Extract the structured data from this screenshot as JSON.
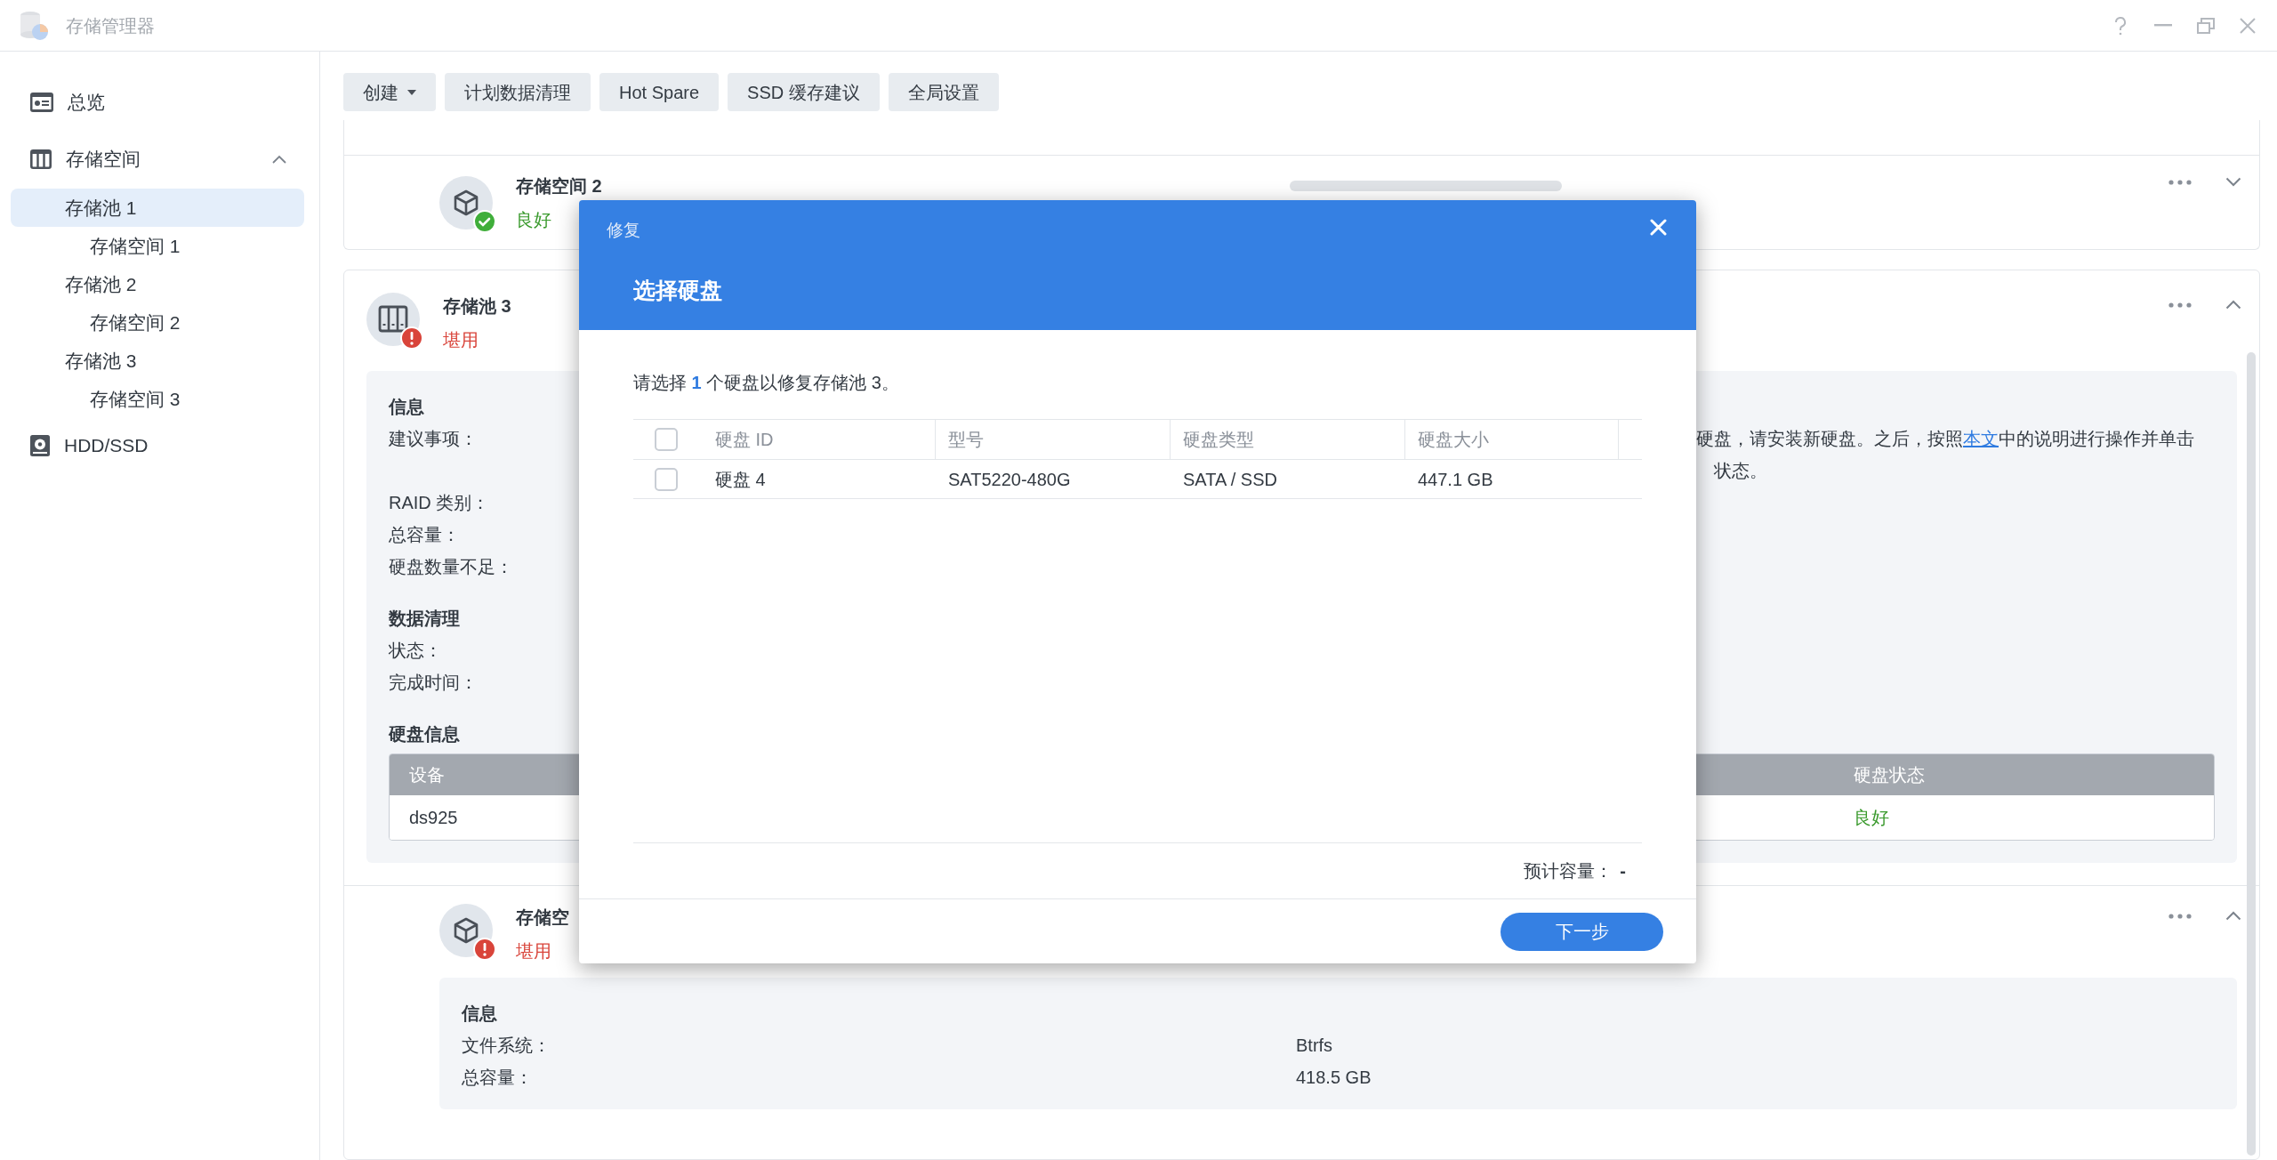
{
  "window": {
    "title": "存储管理器"
  },
  "sidebar": {
    "items": [
      {
        "label": "总览",
        "selected": false
      },
      {
        "label": "存储空间",
        "selected": false,
        "expanded": true,
        "children": [
          {
            "label": "存储池 1",
            "selected": true,
            "children": [
              {
                "label": "存储空间 1",
                "selected": false
              }
            ]
          },
          {
            "label": "存储池 2",
            "selected": false,
            "children": [
              {
                "label": "存储空间 2",
                "selected": false
              }
            ]
          },
          {
            "label": "存储池 3",
            "selected": false,
            "children": [
              {
                "label": "存储空间 3",
                "selected": false
              }
            ]
          }
        ]
      },
      {
        "label": "HDD/SSD",
        "selected": false
      }
    ]
  },
  "toolbar": {
    "buttons": [
      {
        "label": "创建",
        "dropdown": true
      },
      {
        "label": "计划数据清理",
        "dropdown": false
      },
      {
        "label": "Hot Spare",
        "dropdown": false
      },
      {
        "label": "SSD 缓存建议",
        "dropdown": false
      },
      {
        "label": "全局设置",
        "dropdown": false
      }
    ]
  },
  "storage_space_2": {
    "title": "存储空间 2",
    "status": "良好",
    "healthy": true,
    "expanded": false
  },
  "pool_3": {
    "title": "存储池 3",
    "status": "堪用",
    "healthy": false,
    "expanded": true,
    "info": {
      "heading": "信息",
      "recommendation_label": "建议事项：",
      "recommendation": {
        "before": "硬盘，请安装新硬盘。之后，按照",
        "link": "本文",
        "after": "中的说明进行操作并单击",
        "line_2": "状态。"
      },
      "fields": [
        "RAID 类别：",
        "总容量：",
        "硬盘数量不足："
      ]
    },
    "scrub": {
      "heading": "数据清理",
      "fields": [
        "状态：",
        "完成时间："
      ]
    },
    "disks": {
      "heading": "硬盘信息",
      "columns": [
        "设备",
        "硬盘状态"
      ],
      "rows": [
        {
          "device": "ds925",
          "status": "良好",
          "healthy": true
        }
      ]
    }
  },
  "storage_space_3": {
    "title": "存储空",
    "status": "堪用",
    "healthy": false,
    "expanded": true,
    "info": {
      "heading": "信息",
      "fields": [
        {
          "label": "文件系统：",
          "value": "Btrfs"
        },
        {
          "label": "总容量：",
          "value": "418.5 GB"
        }
      ]
    }
  },
  "dialog": {
    "caption": "修复",
    "title": "选择硬盘",
    "prompt": "请选择 **1** 个硬盘以修复存储池 3。",
    "table": {
      "all_checked": false,
      "columns": [
        "硬盘 ID",
        "型号",
        "硬盘类型",
        "硬盘大小"
      ],
      "rows": [
        {
          "id": "硬盘 4",
          "model": "SAT5220-480G",
          "type": "SATA / SSD",
          "size": "447.1 GB",
          "checked": false
        }
      ]
    },
    "estimate": {
      "label": "预计容量：",
      "value": "-"
    },
    "next_button": "下一步"
  }
}
